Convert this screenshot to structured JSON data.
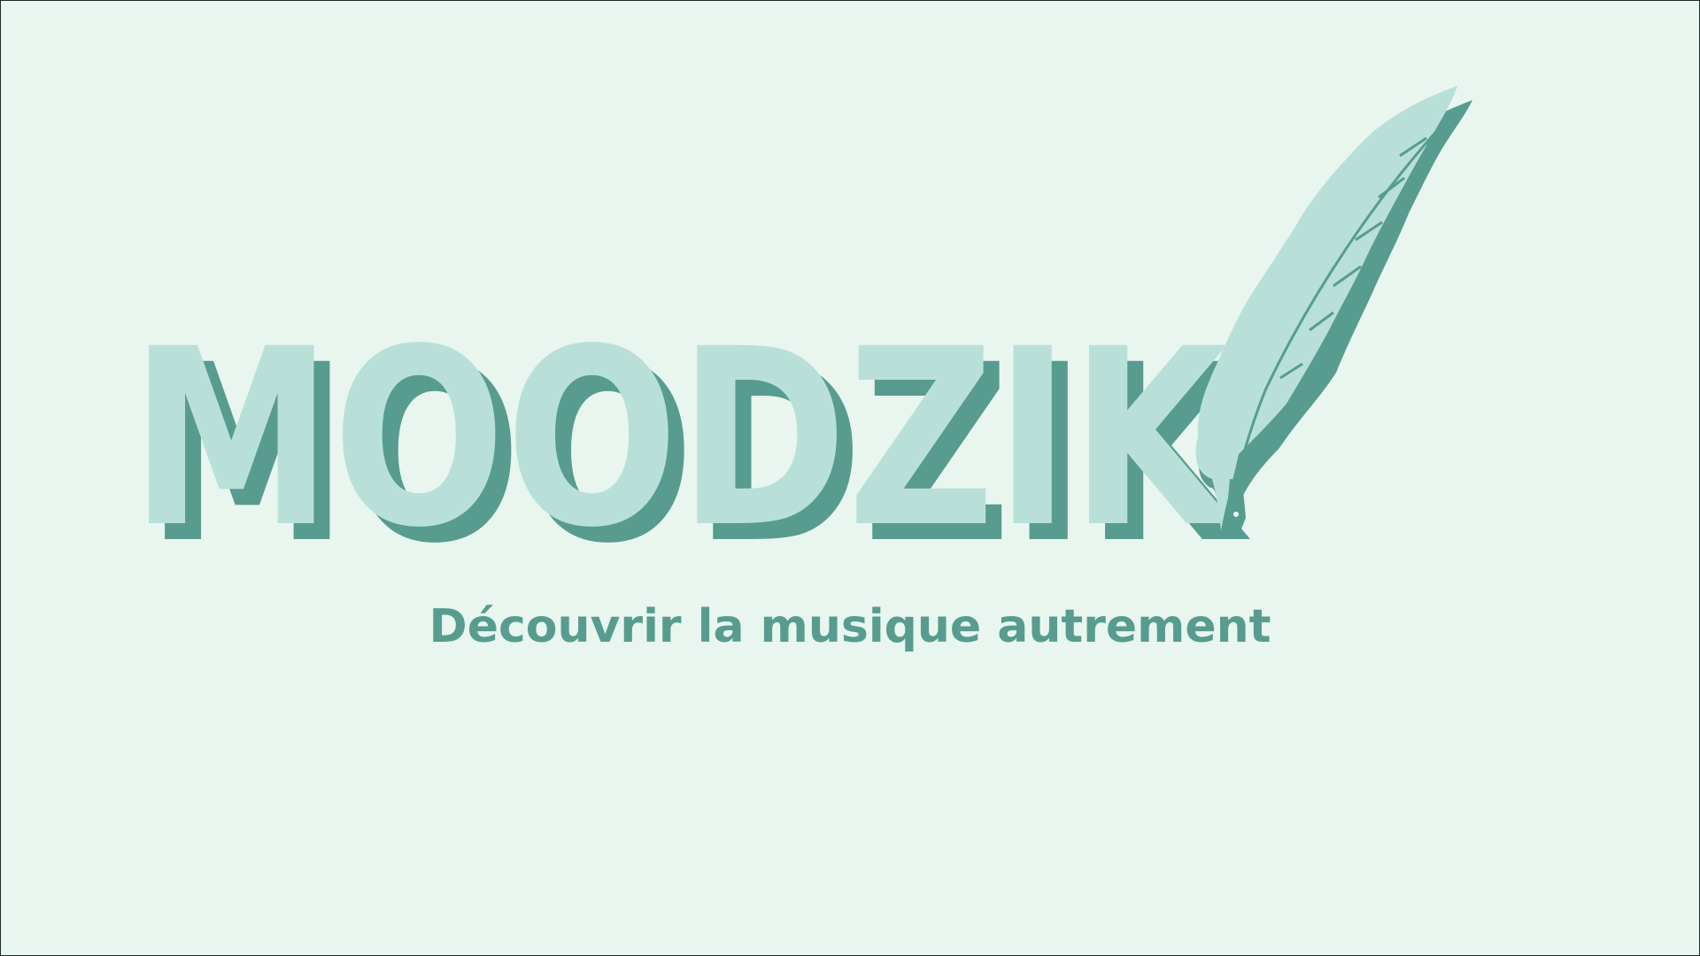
{
  "logo": {
    "wordmark": "MOODZIK",
    "letters": [
      "M",
      "O",
      "O",
      "D",
      "Z",
      "I",
      "K"
    ],
    "feather_icon": "quill-feather-icon"
  },
  "tagline": "Découvrir la musique autrement",
  "colors": {
    "background": "#e8f6ef",
    "light_mint": "#b8e0d9",
    "dark_teal": "#579c8f",
    "border": "#1b2b27"
  }
}
